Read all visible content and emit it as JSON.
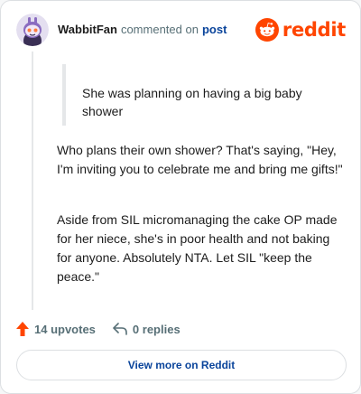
{
  "header": {
    "username": "WabbitFan",
    "action_text": "commented on",
    "post_link": "post",
    "logo_text": "reddit",
    "avatar_icon": "snoo-avatar-icon",
    "logo_icon": "reddit-snoo-icon"
  },
  "comment": {
    "quote": "She was planning on having a big baby shower",
    "paragraphs": [
      "Who plans their own shower? That's saying, \"Hey, I'm inviting you to celebrate me and bring me gifts!\"",
      "Aside from SIL micromanaging the cake OP made for her niece, she's in poor health and not baking for anyone. Absolutely NTA. Let SIL \"keep the peace.\""
    ]
  },
  "actions": {
    "upvotes": "14 upvotes",
    "replies": "0 replies",
    "upvote_icon": "upvote-arrow-icon",
    "reply_icon": "reply-arrow-icon"
  },
  "footer": {
    "view_more": "View more on Reddit"
  },
  "colors": {
    "brand": "#ff4500",
    "link": "#0a449b",
    "muted": "#576f76",
    "border": "#dcdfe2"
  }
}
